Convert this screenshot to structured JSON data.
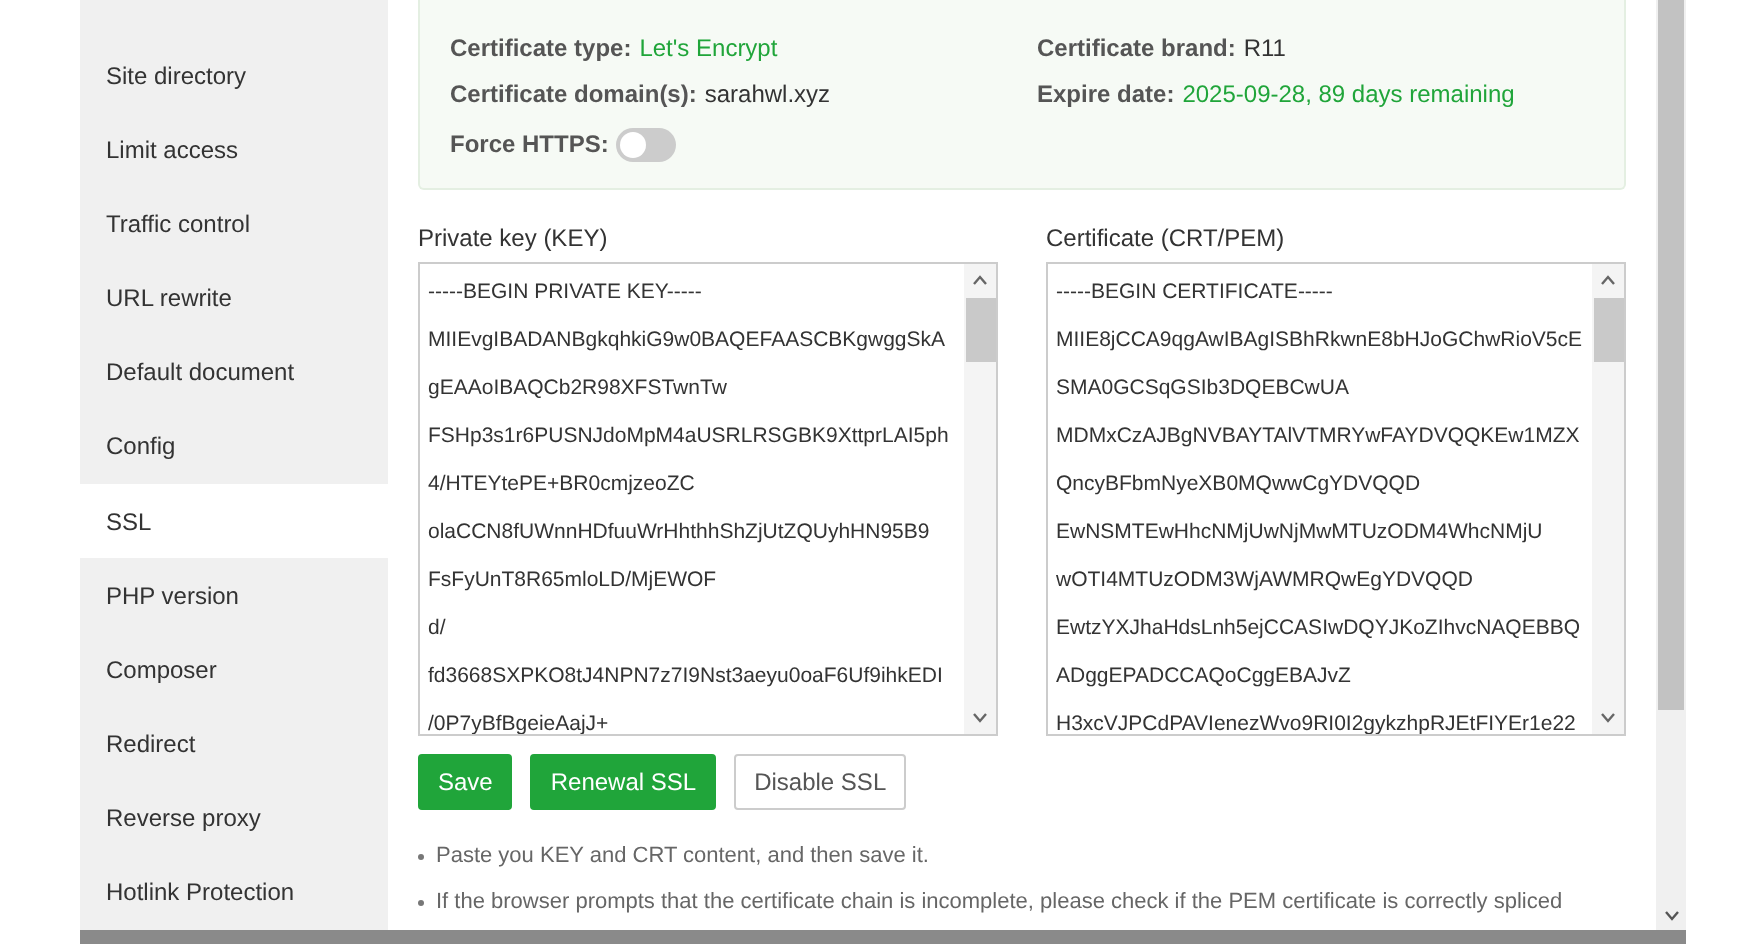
{
  "sidebar": {
    "items": [
      {
        "label": "Site directory",
        "selected": false
      },
      {
        "label": "Limit access",
        "selected": false
      },
      {
        "label": "Traffic control",
        "selected": false
      },
      {
        "label": "URL rewrite",
        "selected": false
      },
      {
        "label": "Default document",
        "selected": false
      },
      {
        "label": "Config",
        "selected": false
      },
      {
        "label": "SSL",
        "selected": true
      },
      {
        "label": "PHP version",
        "selected": false
      },
      {
        "label": "Composer",
        "selected": false
      },
      {
        "label": "Redirect",
        "selected": false
      },
      {
        "label": "Reverse proxy",
        "selected": false
      },
      {
        "label": "Hotlink Protection",
        "selected": false
      }
    ]
  },
  "certificate_info": {
    "fields": [
      {
        "label": "Certificate type:",
        "value": "Let's Encrypt",
        "highlight": true
      },
      {
        "label": "Certificate brand:",
        "value": "R11",
        "highlight": false
      },
      {
        "label": "Certificate domain(s):",
        "value": "sarahwl.xyz",
        "highlight": false
      },
      {
        "label": "Expire date:",
        "value": "2025-09-28, 89 days remaining",
        "highlight": true
      }
    ],
    "force_https": {
      "label": "Force HTTPS:",
      "on": false
    }
  },
  "private_key": {
    "label": "Private key (KEY)",
    "lines": [
      "-----BEGIN PRIVATE KEY-----",
      "MIIEvgIBADANBgkqhkiG9w0BAQEFAASCBKgwggSkA",
      "gEAAoIBAQCb2R98XFSTwnTw",
      "FSHp3s1r6PUSNJdoMpM4aUSRLRSGBK9XttprLAI5ph",
      "4/HTEYtePE+BR0cmjzeoZC",
      "olaCCN8fUWnnHDfuuWrHhthhShZjUtZQUyhHN95B9",
      "FsFyUnT8R65mloLD/MjEWOF",
      "d/",
      "fd3668SXPKO8tJ4NPN7z7I9Nst3aeyu0oaF6Uf9ihkEDI",
      "/0P7yBfBgeieAajJ+"
    ]
  },
  "certificate": {
    "label": "Certificate (CRT/PEM)",
    "lines": [
      "-----BEGIN CERTIFICATE-----",
      "MIIE8jCCA9qgAwIBAgISBhRkwnE8bHJoGChwRioV5cE",
      "SMA0GCSqGSIb3DQEBCwUA",
      "MDMxCzAJBgNVBAYTAlVTMRYwFAYDVQQKEw1MZX",
      "QncyBFbmNyeXB0MQwwCgYDVQQD",
      "EwNSMTEwHhcNMjUwNjMwMTUzODM4WhcNMjU",
      "wOTI4MTUzODM3WjAWMRQwEgYDVQQD",
      "EwtzYXJhaHdsLnh5ejCCASIwDQYJKoZIhvcNAQEBBQ",
      "ADggEPADCCAQoCggEBAJvZ",
      "H3xcVJPCdPAVIenezWvo9RI0I2gykzhpRJEtFIYEr1e22"
    ]
  },
  "buttons": [
    {
      "label": "Save",
      "kind": "primary"
    },
    {
      "label": "Renewal SSL",
      "kind": "primary"
    },
    {
      "label": "Disable SSL",
      "kind": "secondary"
    }
  ],
  "notes": [
    "Paste you KEY and CRT content, and then save it.",
    "If the browser prompts that the certificate chain is incomplete, please check if the PEM certificate is correctly spliced"
  ]
}
